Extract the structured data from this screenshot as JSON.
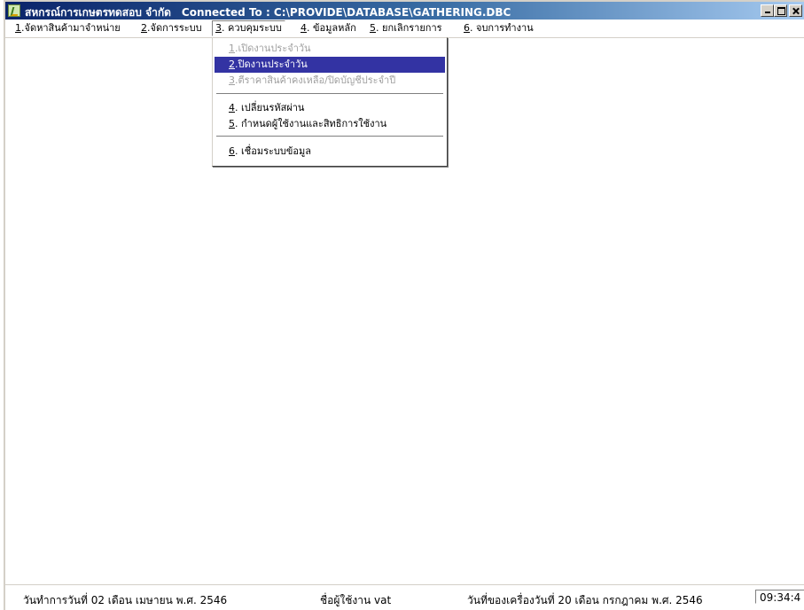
{
  "window": {
    "title": "สหกรณ์การเกษตรทดสอบ จำกัด",
    "connection": "Connected  To  : C:\\PROVIDE\\DATABASE\\GATHERING.DBC"
  },
  "menu": [
    {
      "key": "1",
      "label": ".จัดหาสินค้ามาจำหน่าย"
    },
    {
      "key": "2",
      "label": ".จัดการระบบ"
    },
    {
      "key": "3",
      "label": ". ควบคุมระบบ"
    },
    {
      "key": "4",
      "label": ". ข้อมูลหลัก"
    },
    {
      "key": "5",
      "label": ". ยกเลิกรายการ"
    },
    {
      "key": "6",
      "label": ". จบการทำงาน"
    }
  ],
  "dropdown": {
    "items": [
      {
        "key": "1",
        "label": ".เปิดงานประจำวัน",
        "state": "disabled"
      },
      {
        "key": "2",
        "label": ".ปิดงานประจำวัน",
        "state": "selected"
      },
      {
        "key": "3",
        "label": ".ตีราคาสินค้าคงเหลือ/ปิดบัญชีประจำปี",
        "state": "disabled"
      },
      {
        "key": "4",
        "label": ". เปลี่ยนรหัสผ่าน",
        "state": "normal"
      },
      {
        "key": "5",
        "label": ". กำหนดผู้ใช้งานและสิทธิการใช้งาน",
        "state": "normal"
      },
      {
        "key": "6",
        "label": ". เชื่อมระบบข้อมูล",
        "state": "normal"
      }
    ]
  },
  "status": {
    "work_date": "วันทำการวันที่ 02 เดือน เมษายน  พ.ศ. 2546",
    "user": "ชื่อผู้ใช้งาน vat",
    "machine_date": "วันที่ของเครื่องวันที่ 20 เดือน กรกฎาคม  พ.ศ. 2546",
    "clock": "09:34:4"
  }
}
